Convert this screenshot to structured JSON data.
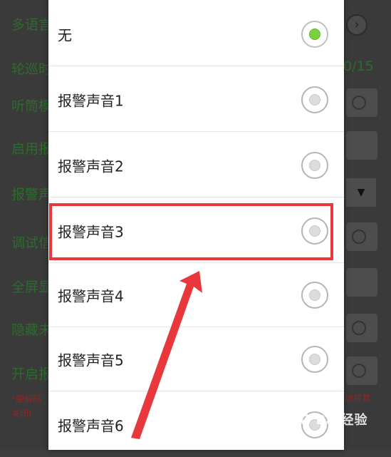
{
  "background": {
    "rows": [
      {
        "label": "多语言"
      },
      {
        "label": "轮巡时"
      },
      {
        "label": "听筒模"
      },
      {
        "label": "启用报"
      },
      {
        "label": "报警声"
      },
      {
        "label": "调试信"
      },
      {
        "label": "全屏显"
      },
      {
        "label": "隐藏未"
      },
      {
        "label": "开启报"
      }
    ],
    "counter": "0/15",
    "note_left": "*硬解码\n关闭!",
    "note_right": "动将其"
  },
  "dialog": {
    "options": [
      {
        "label": "无",
        "checked": true
      },
      {
        "label": "报警声音1",
        "checked": false
      },
      {
        "label": "报警声音2",
        "checked": false
      },
      {
        "label": "报警声音3",
        "checked": false
      },
      {
        "label": "报警声音4",
        "checked": false
      },
      {
        "label": "报警声音5",
        "checked": false
      },
      {
        "label": "报警声音6",
        "checked": false
      }
    ],
    "highlighted_option": "报警声音3"
  },
  "watermark": "Bai经验",
  "colors": {
    "accent_check": "#7ad13d",
    "annotation_red": "#e8383c",
    "bg_label_green": "#2f6a2f"
  }
}
